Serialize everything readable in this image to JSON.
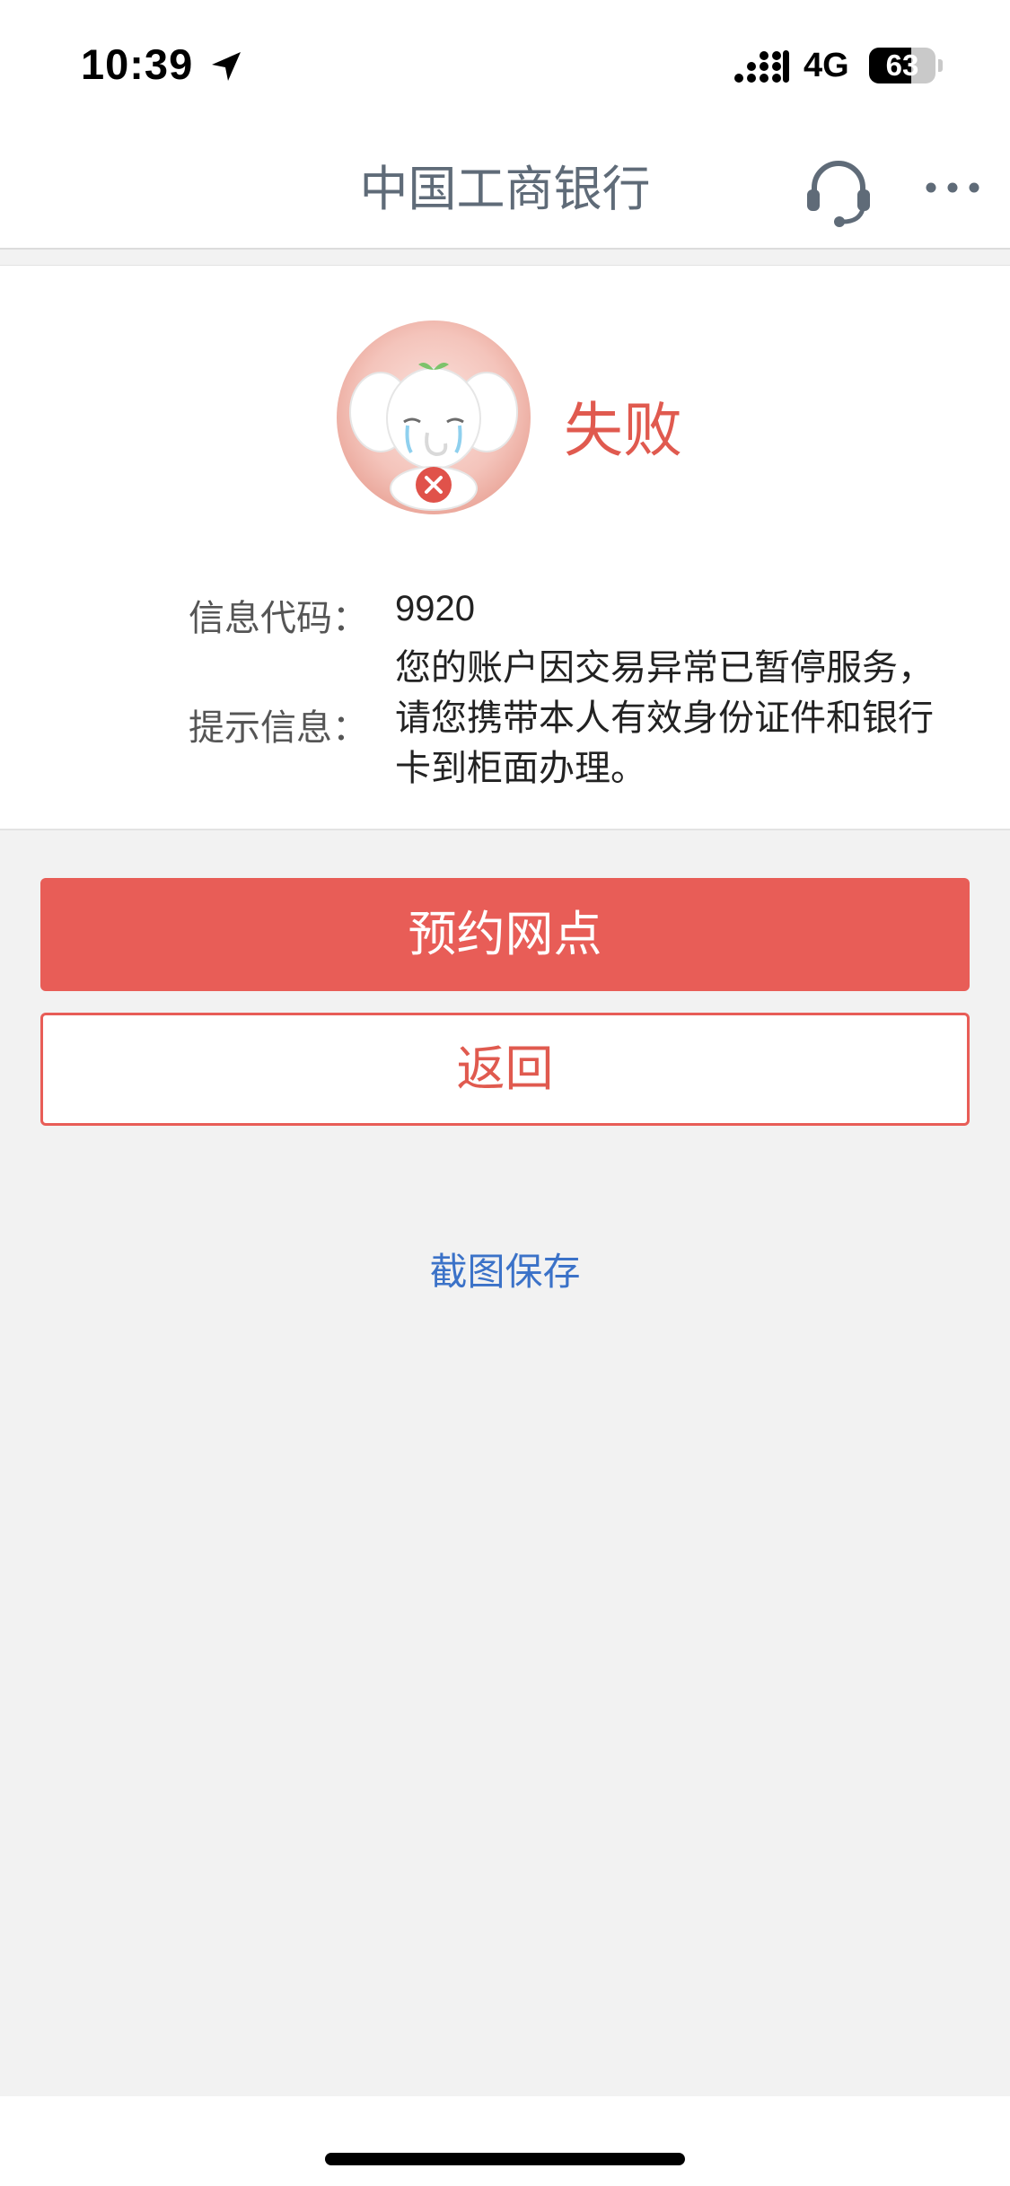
{
  "status_bar": {
    "time": "10:39",
    "network": "4G",
    "battery_level": "63",
    "battery_fraction": 0.63
  },
  "nav": {
    "title": "中国工商银行",
    "support_icon": "headset-icon",
    "more_icon": "more-dots-icon"
  },
  "result": {
    "status": "失败",
    "mascot": "crying-elephant-mascot",
    "code_label": "信息代码：",
    "code_value": "9920",
    "message_label": "提示信息：",
    "message_value": "您的账户因交易异常已暂停服务，请您携带本人有效身份证件和银行卡到柜面办理。"
  },
  "actions": {
    "primary_label": "预约网点",
    "secondary_label": "返回",
    "link_label": "截图保存"
  },
  "colors": {
    "accent": "#e85d57",
    "status_text": "#e05a4f",
    "link": "#3b72c8",
    "background": "#f2f2f2"
  }
}
